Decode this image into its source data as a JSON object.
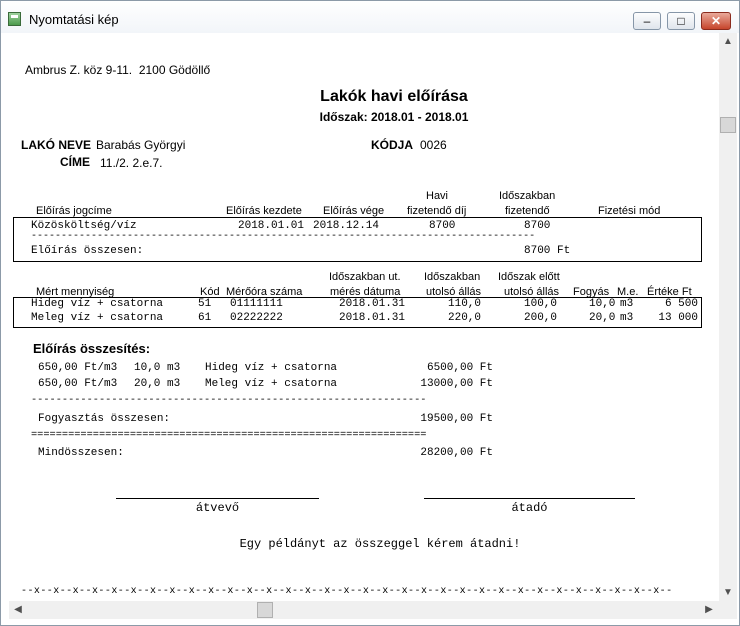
{
  "window": {
    "title": "Nyomtatási kép",
    "minimize": "–",
    "maximize": "□",
    "close": "✕"
  },
  "report": {
    "address": "Ambrus Z. köz 9-11.  2100 Gödöllő",
    "title": "Lakók havi előírása",
    "period": "Időszak: 2018.01 - 2018.01",
    "tenant_name_label": "LAKÓ NEVE",
    "tenant_name": "Barabás Györgyi",
    "code_label": "KÓDJA",
    "code": "0026",
    "address_label": "CÍME",
    "tenant_address": "11./2. 2.e.7.",
    "charges": {
      "headers": {
        "title": "Előírás jogcíme",
        "start": "Előírás kezdete",
        "end": "Előírás vége",
        "monthly_1": "Havi",
        "monthly_2": "fizetendő díj",
        "period_due_1": "Időszakban",
        "period_due_2": "fizetendő",
        "payment": "Fizetési mód"
      },
      "rows": [
        {
          "title": "Közösköltség/víz",
          "start": "2018.01.01",
          "end": "2018.12.14",
          "monthly": "8700",
          "due": "8700"
        }
      ],
      "separator": "------------------------------------------------------------------------------------",
      "total_label": "Előírás összesen:",
      "total_value": "8700 Ft"
    },
    "meters": {
      "headers": {
        "quantity": "Mért mennyiség",
        "code": "Kód",
        "meter_no": "Mérőóra száma",
        "last_date_1": "Időszakban ut.",
        "last_date_2": "mérés dátuma",
        "last_state_1": "Időszakban",
        "last_state_2": "utolsó állás",
        "prev_state_1": "Időszak előtt",
        "prev_state_2": "utolsó állás",
        "consumption": "Fogyás",
        "unit": "M.e.",
        "value": "Értéke Ft"
      },
      "rows": [
        {
          "name": "Hideg víz + csatorna",
          "code": "51",
          "meter": "01111111",
          "date": "2018.01.31",
          "last": "110,0",
          "prev": "100,0",
          "consumption": "10,0",
          "unit": "m3",
          "value": "6 500"
        },
        {
          "name": "Meleg víz + csatorna",
          "code": "61",
          "meter": "02222222",
          "date": "2018.01.31",
          "last": "220,0",
          "prev": "200,0",
          "consumption": "20,0",
          "unit": "m3",
          "value": "13 000"
        }
      ]
    },
    "summary": {
      "heading": "Előírás összesítés:",
      "lines": [
        {
          "price": "650,00 Ft/m3",
          "qty": "10,0 m3",
          "name": "Hideg víz + csatorna",
          "amount": "6500,00 Ft"
        },
        {
          "price": "650,00 Ft/m3",
          "qty": "20,0 m3",
          "name": "Meleg víz + csatorna",
          "amount": "13000,00 Ft"
        }
      ],
      "dash_line": "----------------------------------------------------------------",
      "consumption_label": "Fogyasztás összesen:",
      "consumption_total": "19500,00 Ft",
      "equals_line": "================================================================",
      "grand_label": "Mindösszesen:",
      "grand_total": "28200,00 Ft"
    },
    "signatures": {
      "receiver": "átvevő",
      "giver": "átadó"
    },
    "note": "Egy példányt az összeggel kérem átadni!",
    "cut_line": "--x--x--x--x--x--x--x--x--x--x--x--x--x--x--x--x--x--x--x--x--x--x--x--x--x--x--x--x--x--x--x--x--x--"
  },
  "scrollbar": {
    "up": "▲",
    "down": "▼",
    "left": "◀",
    "right": "▶"
  }
}
